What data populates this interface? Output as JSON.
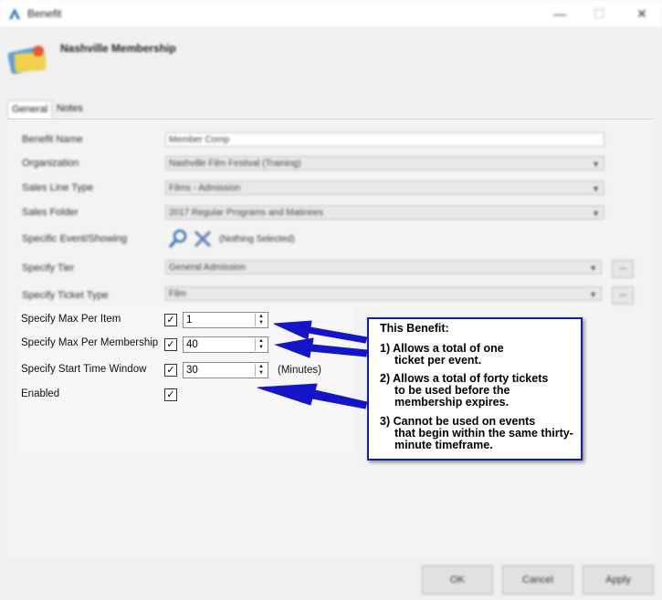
{
  "window": {
    "title": "Benefit",
    "minimize": "—",
    "maximize": "☐",
    "close": "✕"
  },
  "header": {
    "name": "Nashville Membership"
  },
  "tabs": [
    {
      "label": "General"
    },
    {
      "label": "Notes"
    }
  ],
  "form_blurred": {
    "benefit_name_label": "Benefit Name",
    "benefit_name_value": "Member Comp",
    "organization_label": "Organization",
    "organization_value": "Nashville Film Festival (Training)",
    "sales_line_type_label": "Sales Line Type",
    "sales_line_type_value": "Films - Admission",
    "sales_folder_label": "Sales Folder",
    "sales_folder_value": "2017 Regular Programs and Matinees",
    "event_label": "Specific Event/Showing",
    "event_value": "(Nothing Selected)",
    "tier_label": "Specify Tier",
    "tier_value": "General Admission",
    "ticket_type_label": "Specify Ticket Type",
    "ticket_type_value": "Film",
    "browse_label": "..."
  },
  "form": {
    "max_per_item_label": "Specify Max Per Item",
    "max_per_item_value": "1",
    "max_per_membership_label": "Specify Max Per Membership",
    "max_per_membership_value": "40",
    "start_time_window_label": "Specify Start Time Window",
    "start_time_window_value": "30",
    "start_time_window_units": "(Minutes)",
    "enabled_label": "Enabled",
    "check_mark": "✓"
  },
  "callout": {
    "title": "This Benefit:",
    "items": [
      {
        "num": "1)",
        "first": "Allows a total of one",
        "rest": "ticket per event."
      },
      {
        "num": "2)",
        "first": "Allows a total of forty tickets",
        "rest": "to be used before the membership expires."
      },
      {
        "num": "3)",
        "first": "Cannot be used on events",
        "rest": "that begin within the same thirty-minute timeframe."
      }
    ]
  },
  "footer": {
    "ok": "OK",
    "cancel": "Cancel",
    "apply": "Apply"
  },
  "colors": {
    "arrow": "#1515c8",
    "callout_border": "#1a1aa8"
  }
}
